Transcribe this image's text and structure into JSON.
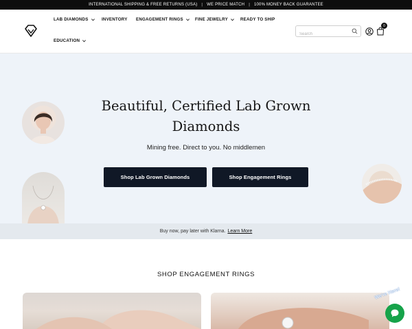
{
  "announcement": {
    "items": [
      "INTERNATIONAL SHIPPING & FREE RETURNS (USA)",
      "WE PRICE MATCH",
      "100% MONEY BACK GUARANTEE"
    ],
    "separator": "|"
  },
  "nav": {
    "items": [
      {
        "label": "LAB DIAMONDS",
        "has_dropdown": true
      },
      {
        "label": "INVENTORY",
        "has_dropdown": false
      },
      {
        "label": "ENGAGEMENT RINGS",
        "has_dropdown": true
      },
      {
        "label": "FINE JEWELRY",
        "has_dropdown": true
      },
      {
        "label": "READY TO SHIP",
        "has_dropdown": false
      },
      {
        "label": "EDUCATION",
        "has_dropdown": true
      }
    ]
  },
  "search": {
    "placeholder": "Search",
    "value": ""
  },
  "cart": {
    "count": "0"
  },
  "hero": {
    "title": "Beautiful, Certified Lab Grown Diamonds",
    "subtitle": "Mining free. Direct to you. No middlemen",
    "primary_button": "Shop Lab Grown Diamonds",
    "secondary_button": "Shop Engagement Rings"
  },
  "klarna": {
    "text": "Buy now, pay later with Klarna.",
    "link": "Learn More"
  },
  "section": {
    "title": "SHOP ENGAGEMENT RINGS"
  },
  "chat": {
    "label": "We're Here!"
  },
  "icons": {
    "logo": "diamond-logo-icon",
    "search": "search-icon",
    "account": "user-icon",
    "cart": "shopping-bag-icon",
    "chevron": "chevron-down-icon",
    "chat": "chat-icon"
  },
  "colors": {
    "topbar": "#0d0d0d",
    "hero_bg": "#eef3f9",
    "button_bg": "#101826",
    "klarna_bg": "#e4e9ee",
    "chat": "#16a34a"
  }
}
